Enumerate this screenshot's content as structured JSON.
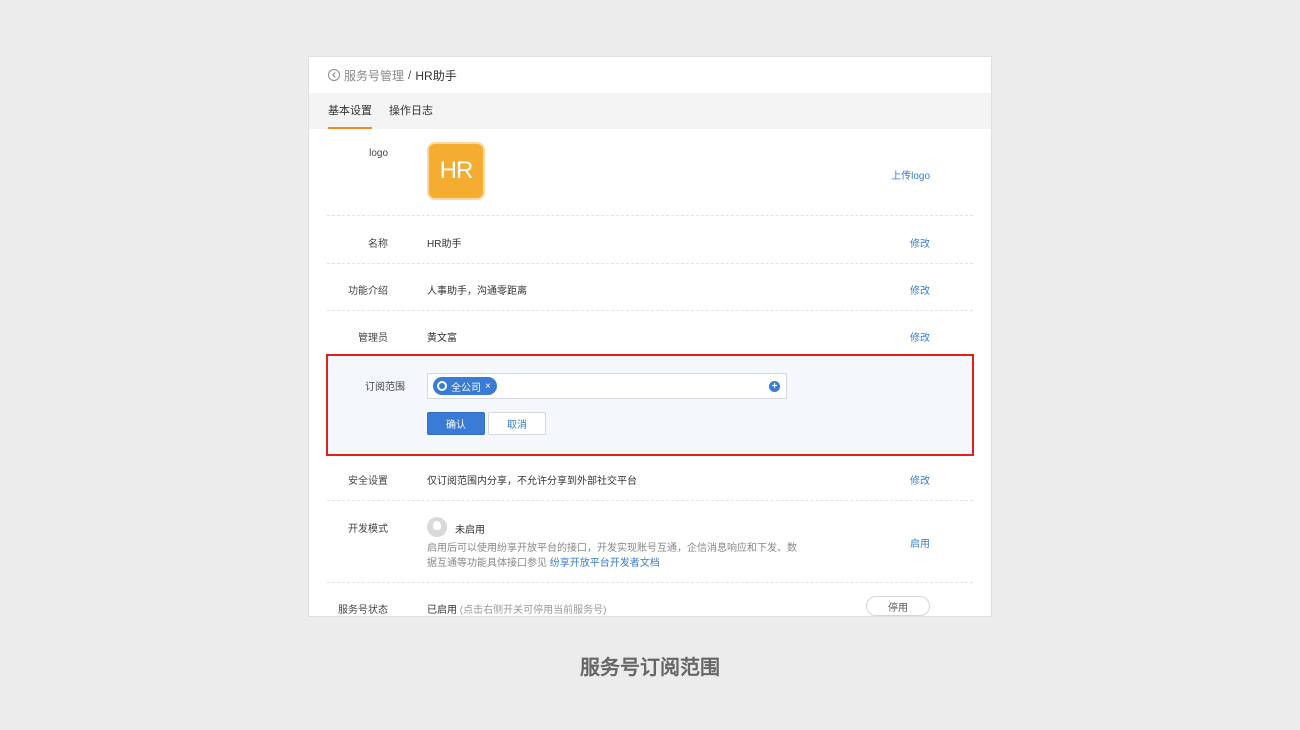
{
  "breadcrumb": {
    "parent": "服务号管理",
    "separator": "/",
    "current": "HR助手"
  },
  "tabs": [
    {
      "label": "基本设置",
      "active": true
    },
    {
      "label": "操作日志",
      "active": false
    }
  ],
  "logo": {
    "label": "logo",
    "text": "HR",
    "action": "上传logo",
    "color": "#f5ad31"
  },
  "name": {
    "label": "名称",
    "value": "HR助手",
    "action": "修改"
  },
  "intro": {
    "label": "功能介绍",
    "value": "人事助手，沟通零距离",
    "action": "修改"
  },
  "admin": {
    "label": "管理员",
    "value": "黄文富",
    "action": "修改"
  },
  "subscription": {
    "label": "订阅范围",
    "tag": "全公司",
    "tag_close": "×",
    "add": "+",
    "confirm": "确认",
    "cancel": "取消",
    "highlight_color": "#e21e1e"
  },
  "security": {
    "label": "安全设置",
    "value": "仅订阅范围内分享，不允许分享到外部社交平台",
    "action": "修改"
  },
  "dev_mode": {
    "label": "开发模式",
    "status": "未启用",
    "description": "启用后可以使用纷享开放平台的接口，开发实现账号互通，企信消息响应和下发、数据互通等功能具体接口参见",
    "link": "纷享开放平台开发者文档",
    "action": "启用"
  },
  "service_status": {
    "label": "服务号状态",
    "value": "已启用",
    "note": "(点击右侧开关可停用当前服务号)",
    "action": "停用"
  },
  "caption": "服务号订阅范围",
  "accent_color": "#3a7bd5",
  "tab_accent_color": "#f08a24"
}
